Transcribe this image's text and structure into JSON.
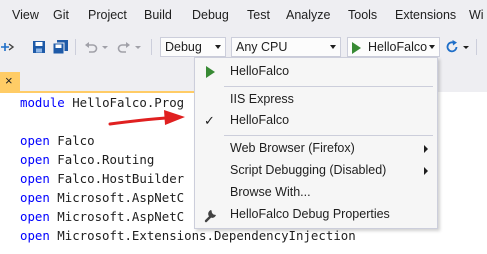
{
  "menu": {
    "items": [
      "View",
      "Git",
      "Project",
      "Build",
      "Debug",
      "Test",
      "Analyze",
      "Tools",
      "Extensions",
      "Wi"
    ]
  },
  "toolbar": {
    "configuration": "Debug",
    "platform": "Any CPU",
    "run_target": "HelloFalco"
  },
  "tab": {
    "close_glyph": "×"
  },
  "dropdown": {
    "items": [
      {
        "label": "HelloFalco",
        "icon": "play-icon"
      },
      {
        "label": "IIS Express"
      },
      {
        "label": "HelloFalco",
        "checked": true
      },
      {
        "label": "Web Browser (Firefox)",
        "submenu": true
      },
      {
        "label": "Script Debugging (Disabled)",
        "submenu": true
      },
      {
        "label": "Browse With..."
      },
      {
        "label": "HelloFalco Debug Properties",
        "icon": "wrench-icon"
      }
    ],
    "check_glyph": "✓"
  },
  "code": {
    "line1_kw": "module",
    "line1_rest": " HelloFalco.Prog",
    "lines": [
      {
        "kw": "open",
        "rest": " Falco"
      },
      {
        "kw": "open",
        "rest": " Falco.Routing"
      },
      {
        "kw": "open",
        "rest": " Falco.HostBuilder"
      },
      {
        "kw": "open",
        "rest": " Microsoft.AspNetC"
      },
      {
        "kw": "open",
        "rest": " Microsoft.AspNetC"
      },
      {
        "kw": "open",
        "rest": " Microsoft.Extensions.DependencyInjection"
      }
    ]
  },
  "colors": {
    "keyword": "#0000ff",
    "run_green": "#388a34",
    "annotation_red": "#e02020",
    "tab_accent": "#ffcc66"
  }
}
